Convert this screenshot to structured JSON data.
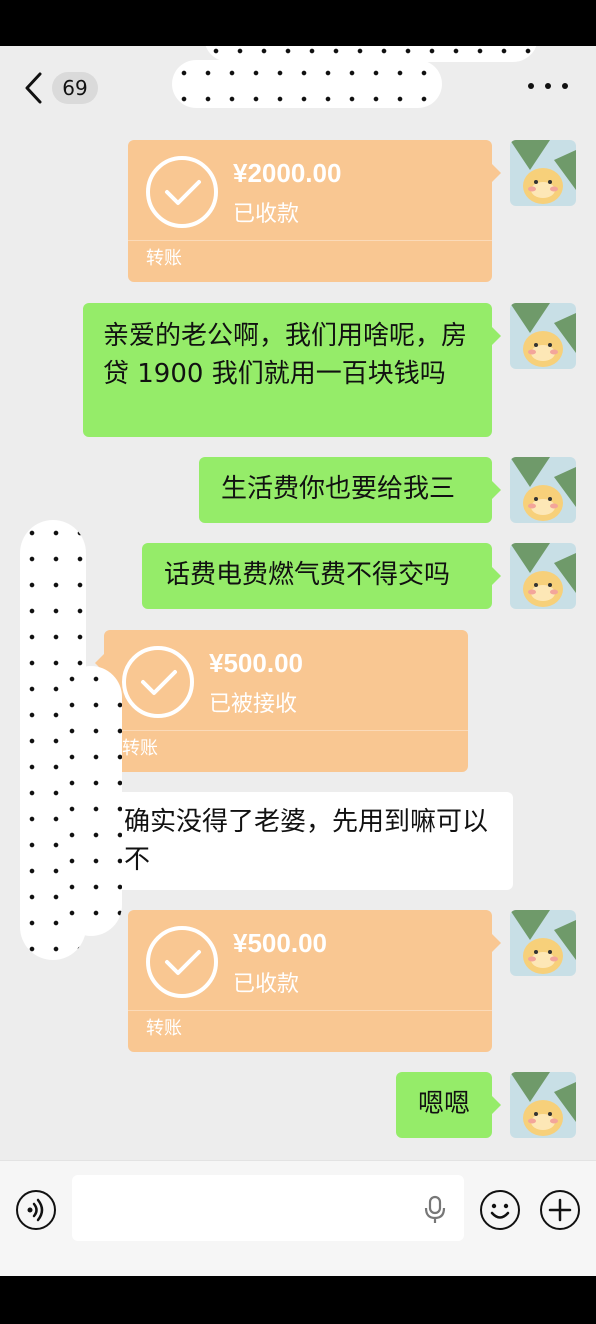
{
  "header": {
    "back_icon": "chevron-left-icon",
    "unread_count": "69",
    "more_icon": "more-dots-icon"
  },
  "messages": [
    {
      "type": "transfer",
      "side": "right",
      "amount": "¥2000.00",
      "status": "已收款",
      "label": "转账"
    },
    {
      "type": "text",
      "side": "right",
      "text": "亲爱的老公啊，我们用啥呢，房贷 1900 我们就用一百块钱吗"
    },
    {
      "type": "text",
      "side": "right",
      "text": "生活费你也要给我三"
    },
    {
      "type": "text",
      "side": "right",
      "text": "话费电费燃气费不得交吗"
    },
    {
      "type": "transfer",
      "side": "left",
      "amount": "¥500.00",
      "status": "已被接收",
      "label": "转账"
    },
    {
      "type": "text",
      "side": "left",
      "text": "确实没得了老婆，先用到嘛可以不"
    },
    {
      "type": "transfer",
      "side": "right",
      "amount": "¥500.00",
      "status": "已收款",
      "label": "转账"
    },
    {
      "type": "text",
      "side": "right",
      "text": "嗯嗯"
    }
  ],
  "input_bar": {
    "voice_icon": "voice-icon",
    "input_placeholder": "",
    "mic_icon": "microphone-icon",
    "emoji_icon": "smiley-icon",
    "plus_icon": "plus-icon"
  },
  "colors": {
    "background": "#ededed",
    "sent_bubble": "#95ec69",
    "received_bubble": "#ffffff",
    "transfer_card": "#f9c792"
  }
}
